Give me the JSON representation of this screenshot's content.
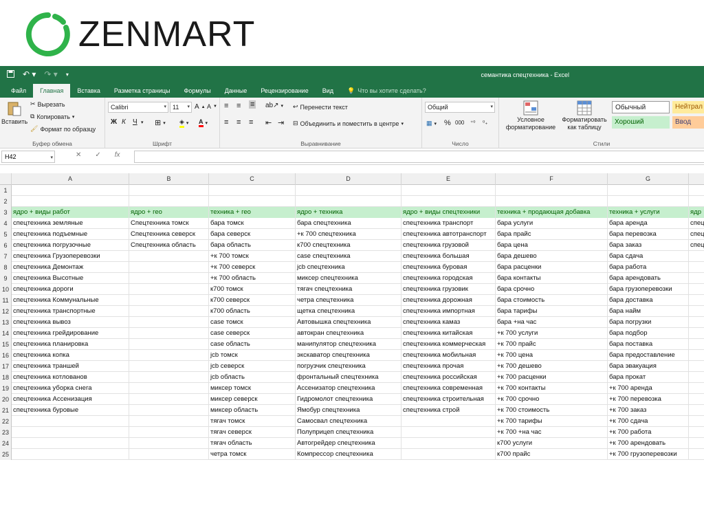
{
  "logo": {
    "brand": "ZENMART"
  },
  "window": {
    "title": "семантика спецтехника - Excel"
  },
  "tabs": [
    {
      "label": "Файл"
    },
    {
      "label": "Главная",
      "active": true
    },
    {
      "label": "Вставка"
    },
    {
      "label": "Разметка страницы"
    },
    {
      "label": "Формулы"
    },
    {
      "label": "Данные"
    },
    {
      "label": "Рецензирование"
    },
    {
      "label": "Вид"
    }
  ],
  "tell_me": "Что вы хотите сделать?",
  "ribbon": {
    "clipboard": {
      "paste": "Вставить",
      "cut": "Вырезать",
      "copy": "Копировать",
      "format_painter": "Формат по образцу",
      "label": "Буфер обмена"
    },
    "font": {
      "name": "Calibri",
      "size": "11",
      "label": "Шрифт",
      "bold": "Ж",
      "italic": "К",
      "underline": "Ч"
    },
    "alignment": {
      "wrap": "Перенести текст",
      "merge": "Объединить и поместить в центре",
      "label": "Выравнивание"
    },
    "number": {
      "format": "Общий",
      "label": "Число"
    },
    "styles": {
      "conditional": "Условное форматирование",
      "as_table": "Форматировать как таблицу",
      "normal": "Обычный",
      "neutral": "Нейтрал",
      "good": "Хороший",
      "input": "Ввод",
      "label": "Стили"
    }
  },
  "formula_bar": {
    "cell_ref": "H42",
    "fx": "fx",
    "value": ""
  },
  "colors": {
    "excel_green": "#217346",
    "header_fill": "#c6efce",
    "header_text": "#006100",
    "input_fill": "#ffcc99",
    "neutral_fill": "#ffeb9c"
  },
  "columns": [
    "A",
    "B",
    "C",
    "D",
    "E",
    "F",
    "G"
  ],
  "rows": [
    {
      "n": "1",
      "cells": [
        "",
        "",
        "",
        "",
        "",
        "",
        "",
        ""
      ]
    },
    {
      "n": "2",
      "cells": [
        "",
        "",
        "",
        "",
        "",
        "",
        "",
        ""
      ]
    },
    {
      "n": "3",
      "header": true,
      "cells": [
        "ядро + виды работ",
        "ядро + гео",
        "техника + гео",
        "ядро + техника",
        "ядро + виды спецтехники",
        "техника + продающая добавка",
        "техника + услуги",
        "ядр"
      ]
    },
    {
      "n": "4",
      "cells": [
        "спецтехника земляные",
        "Спецтехника томск",
        "бара томск",
        "бара спецтехника",
        "спецтехника транспорт",
        "бара услуги",
        "бара аренда",
        "спец"
      ]
    },
    {
      "n": "5",
      "cells": [
        "спецтехника подъемные",
        "Спецтехника северск",
        "бара северск",
        "+к 700 спецтехника",
        "спецтехника автотранспорт",
        "бара прайс",
        "бара перевозка",
        "спец"
      ]
    },
    {
      "n": "6",
      "cells": [
        "спецтехника погрузочные",
        "Спецтехника область",
        "бара область",
        "к700 спецтехника",
        "спецтехника грузовой",
        "бара цена",
        "бара заказ",
        "спец"
      ]
    },
    {
      "n": "7",
      "cells": [
        "спецтехника Грузоперевозки",
        "",
        "+к 700 томск",
        "case спецтехника",
        "спецтехника большая",
        "бара дешево",
        "бара сдача",
        ""
      ]
    },
    {
      "n": "8",
      "cells": [
        "спецтехника Демонтаж",
        "",
        "+к 700 северск",
        "jcb спецтехника",
        "спецтехника буровая",
        "бара расценки",
        "бара работа",
        ""
      ]
    },
    {
      "n": "9",
      "cells": [
        "спецтехника Высотные",
        "",
        "+к 700 область",
        "миксер спецтехника",
        "спецтехника городская",
        "бара контакты",
        "бара арендовать",
        ""
      ]
    },
    {
      "n": "10",
      "cells": [
        "спецтехника дороги",
        "",
        "к700 томск",
        "тягач спецтехника",
        "спецтехника грузовик",
        "бара срочно",
        "бара грузоперевозки",
        ""
      ]
    },
    {
      "n": "11",
      "cells": [
        "спецтехника Коммунальные",
        "",
        "к700 северск",
        "четра спецтехника",
        "спецтехника дорожная",
        "бара стоимость",
        "бара доставка",
        ""
      ]
    },
    {
      "n": "12",
      "cells": [
        "спецтехника транспортные",
        "",
        "к700 область",
        "щетка спецтехника",
        "спецтехника импортная",
        "бара тарифы",
        "бара найм",
        ""
      ]
    },
    {
      "n": "13",
      "cells": [
        "спецтехника вывоз",
        "",
        "case томск",
        "Автовышка спецтехника",
        "спецтехника камаз",
        "бара +на час",
        "бара погрузки",
        ""
      ]
    },
    {
      "n": "14",
      "cells": [
        "спецтехника грейдирование",
        "",
        "case северск",
        "автокран спецтехника",
        "спецтехника китайская",
        "+к 700 услуги",
        "бара подбор",
        ""
      ]
    },
    {
      "n": "15",
      "cells": [
        "спецтехника планировка",
        "",
        "case область",
        "манипулятор спецтехника",
        "спецтехника коммерческая",
        "+к 700 прайс",
        "бара поставка",
        ""
      ]
    },
    {
      "n": "16",
      "cells": [
        "спецтехника копка",
        "",
        "jcb томск",
        "экскаватор спецтехника",
        "спецтехника мобильная",
        "+к 700 цена",
        "бара предоставление",
        ""
      ]
    },
    {
      "n": "17",
      "cells": [
        "спецтехника траншей",
        "",
        "jcb северск",
        "погрузчик спецтехника",
        "спецтехника прочая",
        "+к 700 дешево",
        "бара эвакуация",
        ""
      ]
    },
    {
      "n": "18",
      "cells": [
        "спецтехника котлованов",
        "",
        "jcb область",
        "фронтальный спецтехника",
        "спецтехника российская",
        "+к 700 расценки",
        "бара прокат",
        ""
      ]
    },
    {
      "n": "19",
      "cells": [
        "спецтехника уборка снега",
        "",
        "миксер томск",
        "Ассенизатор спецтехника",
        "спецтехника современная",
        "+к 700 контакты",
        "+к 700 аренда",
        ""
      ]
    },
    {
      "n": "20",
      "cells": [
        "спецтехника Ассенизация",
        "",
        "миксер северск",
        "Гидромолот спецтехника",
        "спецтехника строительная",
        "+к 700 срочно",
        "+к 700 перевозка",
        ""
      ]
    },
    {
      "n": "21",
      "cells": [
        "спецтехника буровые",
        "",
        "миксер область",
        "Ямобур спецтехника",
        "спецтехника строй",
        "+к 700 стоимость",
        "+к 700 заказ",
        ""
      ]
    },
    {
      "n": "22",
      "cells": [
        "",
        "",
        "тягач томск",
        "Самосвал спецтехника",
        "",
        "+к 700 тарифы",
        "+к 700 сдача",
        ""
      ]
    },
    {
      "n": "23",
      "cells": [
        "",
        "",
        "тягач северск",
        "Полуприцеп спецтехника",
        "",
        "+к 700 +на час",
        "+к 700 работа",
        ""
      ]
    },
    {
      "n": "24",
      "cells": [
        "",
        "",
        "тягач область",
        "Автогрейдер спецтехника",
        "",
        "к700 услуги",
        "+к 700 арендовать",
        ""
      ]
    },
    {
      "n": "25",
      "cells": [
        "",
        "",
        "четра томск",
        "Компрессор спецтехника",
        "",
        "к700 прайс",
        "+к 700 грузоперевозки",
        ""
      ]
    }
  ]
}
